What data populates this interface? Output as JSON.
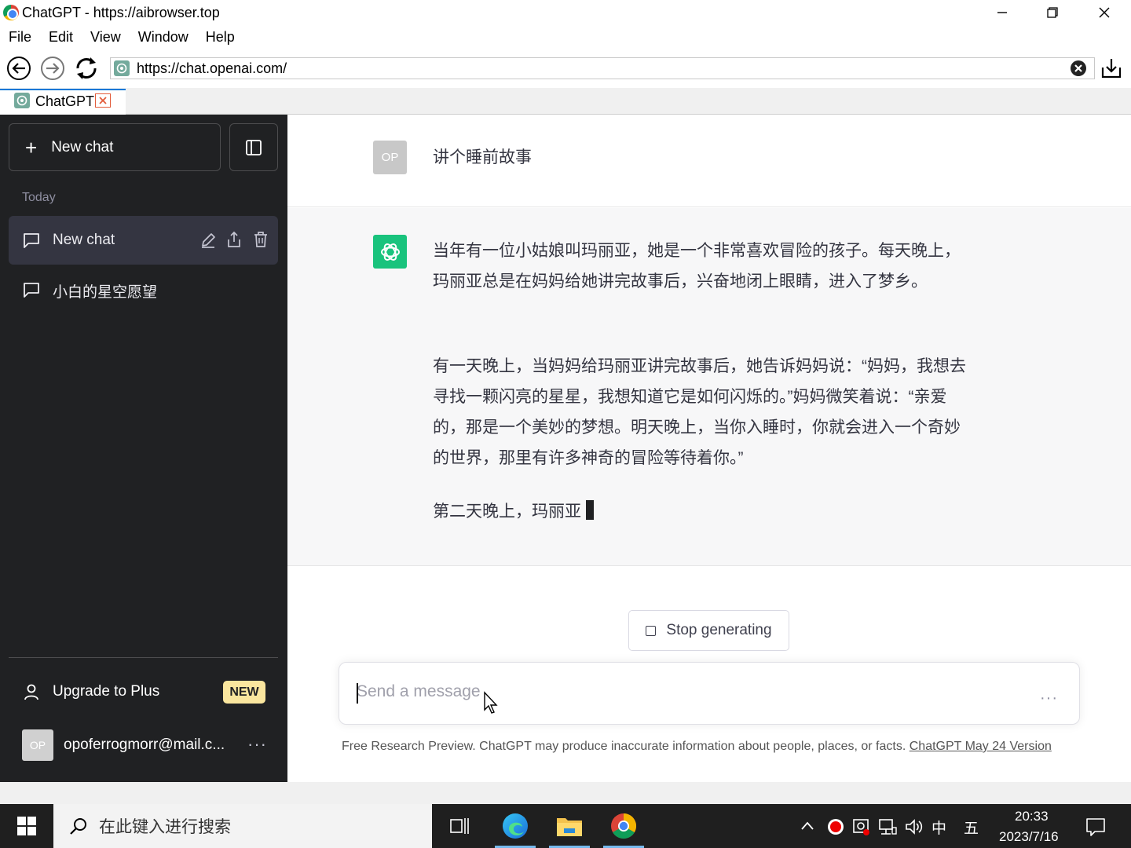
{
  "window": {
    "title": "ChatGPT - https://aibrowser.top"
  },
  "menu": [
    "File",
    "Edit",
    "View",
    "Window",
    "Help"
  ],
  "address_bar": {
    "url": "https://chat.openai.com/"
  },
  "tab": {
    "label": "ChatGPT"
  },
  "sidebar": {
    "new_chat_label": "New chat",
    "section_label": "Today",
    "chats": [
      {
        "label": "New chat"
      },
      {
        "label": "小白的星空愿望"
      }
    ],
    "upgrade_label": "Upgrade to Plus",
    "upgrade_badge": "NEW",
    "account": {
      "initials": "OP",
      "email": "opoferrogmorr@mail.c..."
    }
  },
  "conversation": {
    "user_initials": "OP",
    "user_message": "讲个睡前故事",
    "assistant_paragraphs": [
      "当年有一位小姑娘叫玛丽亚，她是一个非常喜欢冒险的孩子。每天晚上，玛丽亚总是在妈妈给她讲完故事后，兴奋地闭上眼睛，进入了梦乡。",
      "有一天晚上，当妈妈给玛丽亚讲完故事后，她告诉妈妈说：“妈妈，我想去寻找一颗闪亮的星星，我想知道它是如何闪烁的。”妈妈微笑着说：“亲爱的，那是一个美妙的梦想。明天晚上，当你入睡时，你就会进入一个奇妙的世界，那里有许多神奇的冒险等待着你。”",
      "第二天晚上，玛丽亚"
    ]
  },
  "stop_button_label": "Stop generating",
  "composer": {
    "placeholder": "Send a message"
  },
  "disclaimer": {
    "text": "Free Research Preview. ChatGPT may produce inaccurate information about people, places, or facts. ",
    "link": "ChatGPT May 24 Version"
  },
  "taskbar": {
    "search_placeholder": "在此键入进行搜索",
    "ime_mode": "中",
    "ime_layout": "五",
    "time": "20:33",
    "date": "2023/7/16"
  },
  "colors": {
    "sidebar_bg": "#202123",
    "accent_green": "#19c37d",
    "badge_yellow": "#fae69e"
  }
}
